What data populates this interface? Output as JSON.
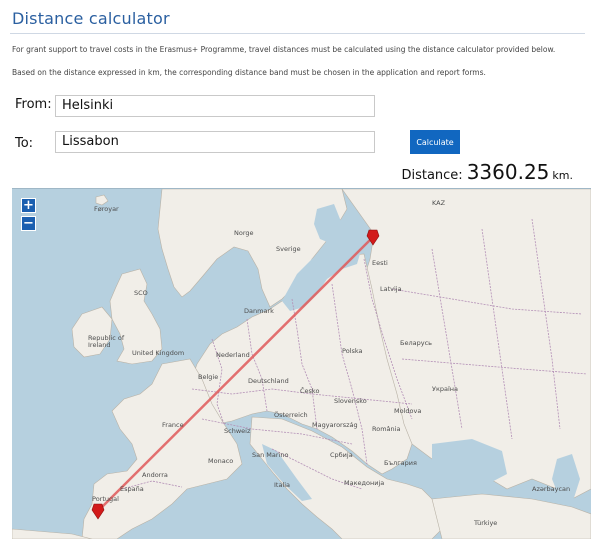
{
  "title": "Distance calculator",
  "intro": [
    "For grant support to travel costs in the Erasmus+ Programme, travel distances must be calculated using the distance calculator provided below.",
    "Based on the distance expressed in km, the corresponding distance band must be chosen in the application and report forms."
  ],
  "form": {
    "from_label": "From:",
    "from_value": "Helsinki",
    "to_label": "To:",
    "to_value": "Lissabon",
    "calculate_label": "Calculate"
  },
  "result": {
    "label": "Distance:",
    "value": "3360.25",
    "unit": "km."
  },
  "map": {
    "zoom_in": "+",
    "zoom_out": "−",
    "labels": {
      "faroe": "Føroyar",
      "norge": "Norge",
      "sverige": "Sverige",
      "eesti": "Eesti",
      "latvija": "Latvija",
      "danmark": "Danmark",
      "sco": "SCO",
      "ireland": "Republic of Ireland",
      "united_kingdom": "United Kingdom",
      "nederland": "Nederland",
      "polska": "Polska",
      "belarus": "Беларусь",
      "deutschland": "Deutschland",
      "belgie": "Belgie",
      "cesko": "Česko",
      "slovensko": "Slovensko",
      "osterreich": "Österreich",
      "schweiz": "Schweiz",
      "magyarorszag": "Magyarország",
      "romania": "România",
      "moldova": "Moldova",
      "ukraine": "Україна",
      "france": "France",
      "monaco": "Monaco",
      "san_marino": "San Marino",
      "srbija": "Србија",
      "bulgaria": "България",
      "makedonija": "Македонија",
      "italia": "Italia",
      "andorra": "Andorra",
      "espana": "España",
      "portugal": "Portugal",
      "turkiye": "Türkiye",
      "azerbaijan": "Azərbaycan",
      "kaz": "KAZ"
    },
    "colors": {
      "sea": "#b6d0df",
      "land": "#f1eee8",
      "route": "#e05a5a",
      "marker": "#d21a1a",
      "border": "#b38fb6"
    }
  }
}
